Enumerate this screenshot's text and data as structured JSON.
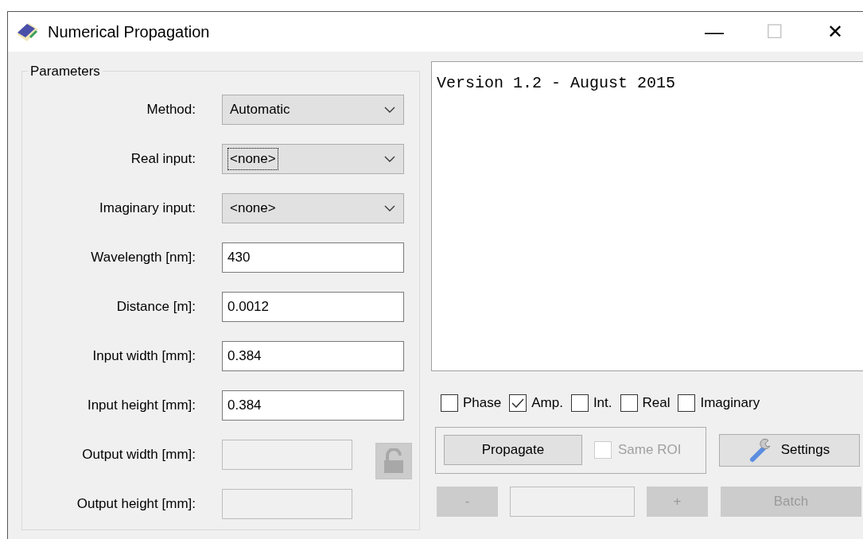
{
  "window": {
    "title": "Numerical Propagation",
    "controls": [
      "—",
      "☐",
      "✕"
    ]
  },
  "parameters": {
    "title": "Parameters",
    "fields": [
      {
        "kind": "dropdown",
        "label": "Method:",
        "value": "Automatic",
        "focused": false
      },
      {
        "kind": "dropdown",
        "label": "Real input:",
        "value": "<none>",
        "focused": true
      },
      {
        "kind": "dropdown",
        "label": "Imaginary input:",
        "value": "<none>",
        "focused": false
      },
      {
        "kind": "text",
        "label": "Wavelength [nm]:",
        "value": "430",
        "disabled": false
      },
      {
        "kind": "text",
        "label": "Distance [m]:",
        "value": "0.0012",
        "disabled": false
      },
      {
        "kind": "text",
        "label": "Input width [mm]:",
        "value": "0.384",
        "disabled": false
      },
      {
        "kind": "text",
        "label": "Input height [mm]:",
        "value": "0.384",
        "disabled": false
      },
      {
        "kind": "text",
        "label": "Output width [mm]:",
        "disabled": true
      },
      {
        "kind": "text",
        "label": "Output height [mm]:",
        "disabled": true
      }
    ],
    "lock": {
      "disabled": true
    }
  },
  "log": {
    "text": "Version 1.2 - August 2015"
  },
  "outputs": [
    {
      "label": "Phase",
      "checked": false
    },
    {
      "label": "Amp.",
      "checked": true
    },
    {
      "label": "Int.",
      "checked": false
    },
    {
      "label": "Real",
      "checked": false
    },
    {
      "label": "Imaginary",
      "checked": false
    }
  ],
  "propagate": {
    "label": "Propagate",
    "disabled": false
  },
  "same_roi": {
    "label": "Same ROI",
    "checked": false,
    "disabled": true
  },
  "settings": {
    "label": "Settings"
  },
  "batch": {
    "minus": {
      "label": "-",
      "disabled": true
    },
    "field": {
      "disabled": true
    },
    "plus": {
      "label": "+",
      "disabled": true
    },
    "run": {
      "label": "Batch",
      "disabled": true
    }
  }
}
